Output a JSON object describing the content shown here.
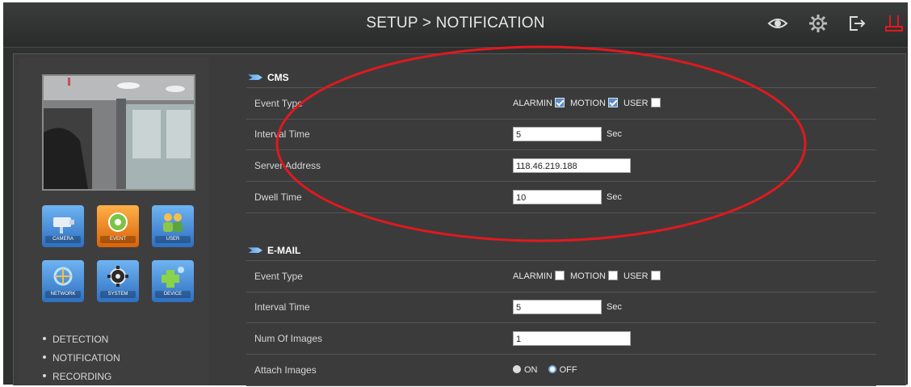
{
  "header": {
    "title": "SETUP > NOTIFICATION",
    "icons": [
      "eye-icon",
      "gear-icon",
      "logout-icon",
      "power-icon"
    ]
  },
  "categories": [
    {
      "name": "camera",
      "label": "CAMERA",
      "color": "#3c86d8"
    },
    {
      "name": "event",
      "label": "EVENT",
      "color": "#e57b13"
    },
    {
      "name": "user",
      "label": "USER",
      "color": "#3c86d8"
    },
    {
      "name": "network",
      "label": "NETWORK",
      "color": "#3c86d8"
    },
    {
      "name": "system",
      "label": "SYSTEM",
      "color": "#3c86d8"
    },
    {
      "name": "device",
      "label": "DEVICE",
      "color": "#3c86d8"
    }
  ],
  "menu": [
    "DETECTION",
    "NOTIFICATION",
    "RECORDING"
  ],
  "cms": {
    "title": "CMS",
    "event_type_label": "Event Type",
    "event_options": [
      {
        "label": "ALARMIN",
        "checked": true
      },
      {
        "label": "MOTION",
        "checked": true
      },
      {
        "label": "USER",
        "checked": false
      }
    ],
    "interval_label": "Interval Time",
    "interval_value": "5",
    "interval_unit": "Sec",
    "server_label": "Server Address",
    "server_value": "118.46.219.188",
    "dwell_label": "Dwell Time",
    "dwell_value": "10",
    "dwell_unit": "Sec"
  },
  "email": {
    "title": "E-MAIL",
    "event_type_label": "Event Type",
    "event_options": [
      {
        "label": "ALARMIN",
        "checked": false
      },
      {
        "label": "MOTION",
        "checked": false
      },
      {
        "label": "USER",
        "checked": false
      }
    ],
    "interval_label": "Interval Time",
    "interval_value": "5",
    "interval_unit": "Sec",
    "num_images_label": "Num Of Images",
    "num_images_value": "1",
    "attach_label": "Attach Images",
    "attach_on": "ON",
    "attach_off": "OFF",
    "attach_selected": "OFF"
  },
  "annotation_color": "#e0191e"
}
